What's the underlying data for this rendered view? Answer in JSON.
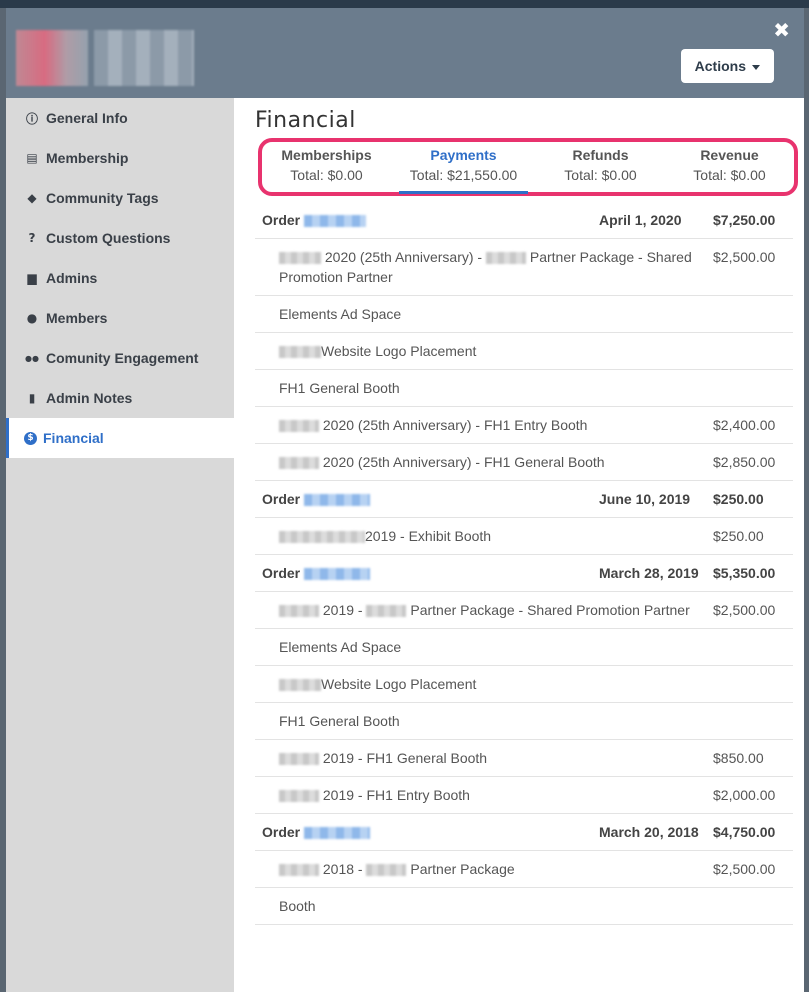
{
  "header": {
    "actions_label": "Actions",
    "close_glyph": "✖"
  },
  "sidebar": {
    "items": [
      {
        "label": "General Info",
        "icon": "info-circle-icon",
        "glyph": "ⓘ"
      },
      {
        "label": "Membership",
        "icon": "id-card-icon",
        "glyph": "▤"
      },
      {
        "label": "Community Tags",
        "icon": "tag-icon",
        "glyph": "◆"
      },
      {
        "label": "Custom Questions",
        "icon": "question-circle-icon",
        "glyph": "?"
      },
      {
        "label": "Admins",
        "icon": "briefcase-icon",
        "glyph": "▆"
      },
      {
        "label": "Members",
        "icon": "user-icon",
        "glyph": "●"
      },
      {
        "label": "Comunity Engagement",
        "icon": "users-icon",
        "glyph": "●●"
      },
      {
        "label": "Admin Notes",
        "icon": "clipboard-icon",
        "glyph": "▮"
      },
      {
        "label": "Financial",
        "icon": "dollar-circle-icon",
        "glyph": "$"
      }
    ]
  },
  "main": {
    "title": "Financial",
    "tabs": [
      {
        "name": "Memberships",
        "total": "Total: $0.00"
      },
      {
        "name": "Payments",
        "total": "Total: $21,550.00"
      },
      {
        "name": "Refunds",
        "total": "Total: $0.00"
      },
      {
        "name": "Revenue",
        "total": "Total: $0.00"
      }
    ],
    "orders": [
      {
        "label": "Order",
        "date": "April 1, 2020",
        "amount": "$7,250.00",
        "items": [
          {
            "text": "2020 (25th Anniversary) - ",
            "text2": " Partner Package - Shared Promotion Partner",
            "amount": "$2,500.00"
          },
          {
            "text": "Elements Ad Space",
            "amount": ""
          },
          {
            "text": "Website Logo Placement",
            "amount": ""
          },
          {
            "text": "FH1 General Booth",
            "amount": ""
          },
          {
            "text": "2020 (25th Anniversary) - FH1 Entry Booth",
            "amount": "$2,400.00"
          },
          {
            "text": "2020 (25th Anniversary) - FH1 General Booth",
            "amount": "$2,850.00"
          }
        ]
      },
      {
        "label": "Order",
        "date": "June 10, 2019",
        "amount": "$250.00",
        "items": [
          {
            "text": "2019 - Exhibit Booth",
            "amount": "$250.00"
          }
        ]
      },
      {
        "label": "Order",
        "date": "March 28, 2019",
        "amount": "$5,350.00",
        "items": [
          {
            "text": "2019 - ",
            "text2": " Partner Package - Shared Promotion Partner",
            "amount": "$2,500.00"
          },
          {
            "text": "Elements Ad Space",
            "amount": ""
          },
          {
            "text": "Website Logo Placement",
            "amount": ""
          },
          {
            "text": "FH1 General Booth",
            "amount": ""
          },
          {
            "text": "2019 - FH1 General Booth",
            "amount": "$850.00"
          },
          {
            "text": "2019 - FH1 Entry Booth",
            "amount": "$2,000.00"
          }
        ]
      },
      {
        "label": "Order",
        "date": "March 20, 2018",
        "amount": "$4,750.00",
        "items": [
          {
            "text": "2018 - ",
            "text2": " Partner Package",
            "amount": "$2,500.00"
          },
          {
            "text": "Booth",
            "amount": ""
          }
        ]
      }
    ]
  },
  "colors": {
    "accent": "#2f6fc8",
    "highlight": "#e8336e",
    "header_bg": "#6b7c8d",
    "sidebar_bg": "#d9d9d9"
  }
}
